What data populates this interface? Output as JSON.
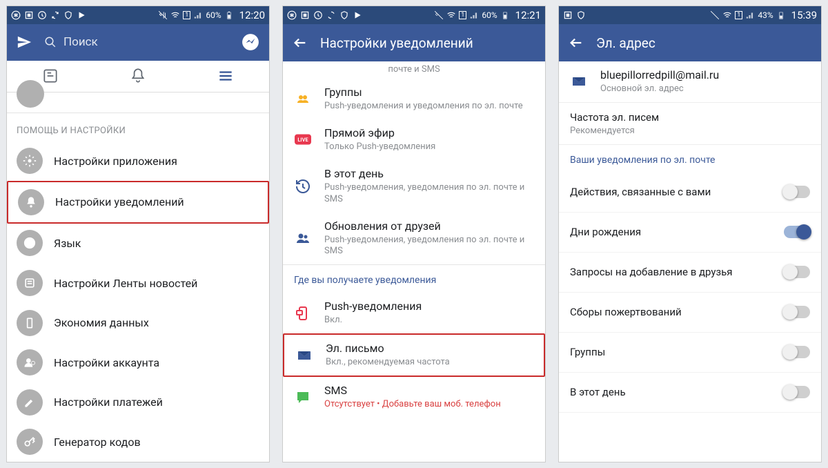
{
  "status": {
    "battery1": "60%",
    "time1": "12:20",
    "battery2": "60%",
    "time2": "12:21",
    "battery3": "43%",
    "time3": "15:39"
  },
  "phone1": {
    "search_placeholder": "Поиск",
    "section": "ПОМОЩЬ И НАСТРОЙКИ",
    "items": [
      "Настройки приложения",
      "Настройки уведомлений",
      "Язык",
      "Настройки Ленты новостей",
      "Экономия данных",
      "Настройки аккаунта",
      "Настройки платежей",
      "Генератор кодов"
    ]
  },
  "phone2": {
    "title": "Настройки уведомлений",
    "partial": "почте и SMS",
    "items": [
      {
        "title": "Группы",
        "sub": "Push-уведомления и уведомления по эл. почте"
      },
      {
        "title": "Прямой эфир",
        "sub": "Только Push-уведомления"
      },
      {
        "title": "В этот день",
        "sub": "Push-уведомления, уведомления по эл. почте и SMS"
      },
      {
        "title": "Обновления от друзей",
        "sub": "Push-уведомления, уведомления по эл. почте и SMS"
      }
    ],
    "section2": "Где вы получаете уведомления",
    "channels": [
      {
        "title": "Push-уведомления",
        "sub": "Вкл."
      },
      {
        "title": "Эл. письмо",
        "sub": "Вкл., рекомендуемая частота"
      },
      {
        "title": "SMS",
        "sub": "Отсутствует • Добавьте ваш моб. телефон"
      }
    ]
  },
  "phone3": {
    "title": "Эл. адрес",
    "email": "bluepillorredpill@mail.ru",
    "email_sub": "Основной эл. адрес",
    "freq_title": "Частота эл. писем",
    "freq_sub": "Рекомендуется",
    "section": "Ваши уведомления по эл. почте",
    "toggles": [
      {
        "label": "Действия, связанные с вами",
        "on": false
      },
      {
        "label": "Дни рождения",
        "on": true
      },
      {
        "label": "Запросы на добавление в друзья",
        "on": false
      },
      {
        "label": "Сборы пожертвований",
        "on": false
      },
      {
        "label": "Группы",
        "on": false
      },
      {
        "label": "В этот день",
        "on": false
      }
    ]
  }
}
